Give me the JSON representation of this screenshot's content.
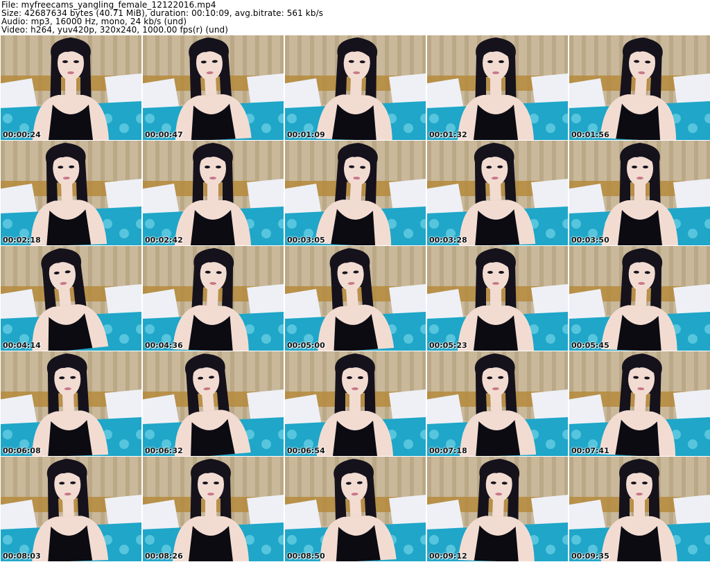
{
  "header": {
    "file_line": "File: myfreecams_yangling_female_12122016.mp4",
    "size_line": "Size: 42687634 bytes (40.71 MiB), duration: 00:10:09, avg.bitrate: 561 kb/s",
    "audio_line": "Audio: mp3, 16000 Hz, mono, 24 kb/s (und)",
    "video_line": "Video: h264, yuv420p, 320x240, 1000.00 fps(r) (und)"
  },
  "thumbnails": [
    {
      "timestamp": "00:00:24"
    },
    {
      "timestamp": "00:00:47"
    },
    {
      "timestamp": "00:01:09"
    },
    {
      "timestamp": "00:01:32"
    },
    {
      "timestamp": "00:01:56"
    },
    {
      "timestamp": "00:02:18"
    },
    {
      "timestamp": "00:02:42"
    },
    {
      "timestamp": "00:03:05"
    },
    {
      "timestamp": "00:03:28"
    },
    {
      "timestamp": "00:03:50"
    },
    {
      "timestamp": "00:04:14"
    },
    {
      "timestamp": "00:04:36"
    },
    {
      "timestamp": "00:05:00"
    },
    {
      "timestamp": "00:05:23"
    },
    {
      "timestamp": "00:05:45"
    },
    {
      "timestamp": "00:06:08"
    },
    {
      "timestamp": "00:06:32"
    },
    {
      "timestamp": "00:06:54"
    },
    {
      "timestamp": "00:07:18"
    },
    {
      "timestamp": "00:07:41"
    },
    {
      "timestamp": "00:08:03"
    },
    {
      "timestamp": "00:08:26"
    },
    {
      "timestamp": "00:08:50"
    },
    {
      "timestamp": "00:09:12"
    },
    {
      "timestamp": "00:09:35"
    }
  ],
  "colors": {
    "curtain": "#c9b89a",
    "curtain_stripe": "#a8946f",
    "pillow": "#eef0f6",
    "bedspread": "#1fa6c8",
    "bedspread_pattern": "#6fd3e6",
    "headboard": "#b58a3c",
    "skin": "#f2dcd2",
    "hair": "#15121c",
    "top": "#0c0b12"
  }
}
